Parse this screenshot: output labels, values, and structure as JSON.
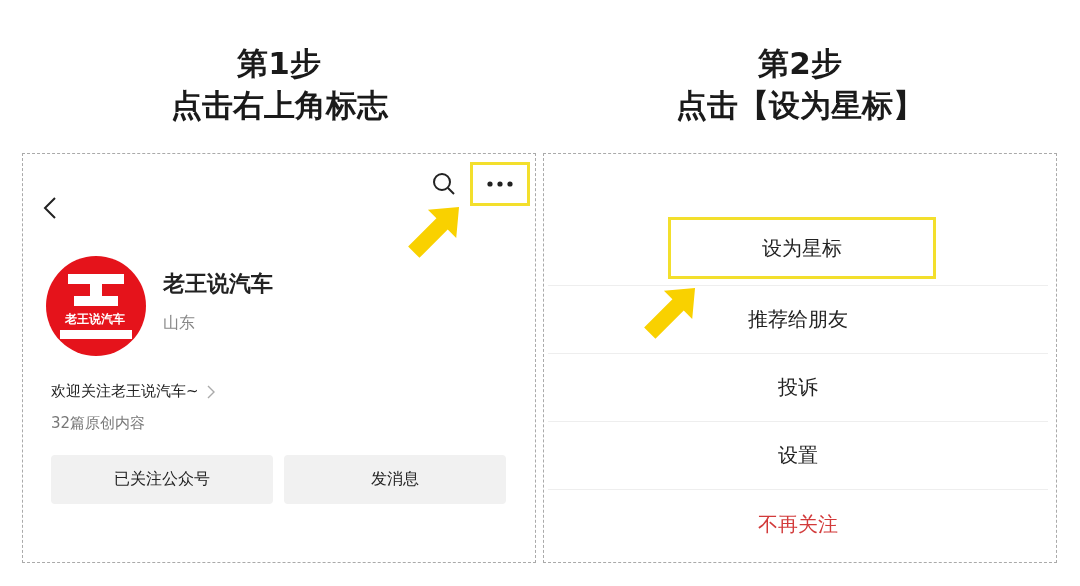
{
  "steps": [
    {
      "title": "第1步",
      "subtitle": "点击右上角标志"
    },
    {
      "title": "第2步",
      "subtitle": "点击【设为星标】"
    }
  ],
  "profile": {
    "more_highlighted": true,
    "avatar_caption": "老王说汽车",
    "name": "老王说汽车",
    "location": "山东",
    "intro": "欢迎关注老王说汽车~",
    "count": "32篇原创内容",
    "buttons": [
      "已关注公众号",
      "发消息"
    ]
  },
  "menu": [
    {
      "label": "设为星标",
      "kind": "normal",
      "highlighted": true
    },
    {
      "label": "推荐给朋友",
      "kind": "normal",
      "highlighted": false
    },
    {
      "label": "投诉",
      "kind": "normal",
      "highlighted": false
    },
    {
      "label": "设置",
      "kind": "normal",
      "highlighted": false
    },
    {
      "label": "不再关注",
      "kind": "danger",
      "highlighted": false
    }
  ]
}
